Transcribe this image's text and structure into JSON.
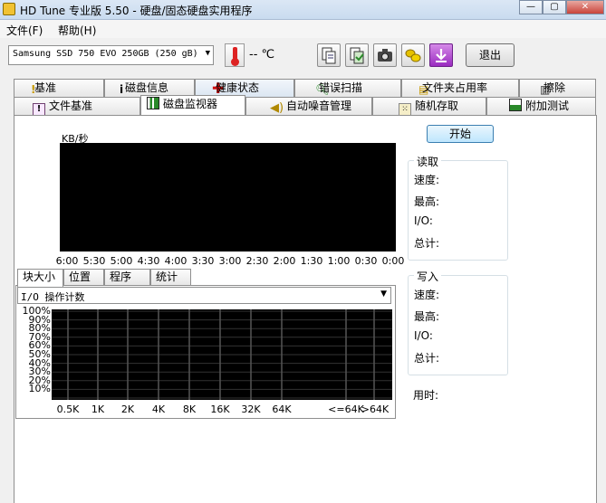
{
  "window": {
    "title": "HD Tune 专业版 5.50 - 硬盘/固态硬盘实用程序",
    "controls": [
      "—",
      "▢",
      "✕"
    ]
  },
  "menu": {
    "file": "文件(F)",
    "help": "帮助(H)"
  },
  "toolbar": {
    "drive": "Samsung SSD 750 EVO 250GB (250 gB)",
    "temperature": "-- ℃",
    "exit_label": "退出",
    "icons": [
      "copy-icon",
      "copy-all-icon",
      "camera-icon",
      "gold-coins-icon",
      "download-icon"
    ]
  },
  "tabs_row1": [
    {
      "label": "基准",
      "icon": "exclamation-icon"
    },
    {
      "label": "磁盘信息",
      "icon": "info-icon"
    },
    {
      "label": "健康状态",
      "icon": "red-cross-icon"
    },
    {
      "label": "错误扫描",
      "icon": "magnifier-icon"
    },
    {
      "label": "文件夹占用率",
      "icon": "folder-icon"
    },
    {
      "label": "擦除",
      "icon": "trash-icon"
    }
  ],
  "tabs_row2": [
    {
      "label": "文件基准",
      "icon": "file-benchmark-icon"
    },
    {
      "label": "磁盘监视器",
      "icon": "monitor-chart-icon",
      "active": true
    },
    {
      "label": "自动噪音管理",
      "icon": "speaker-icon"
    },
    {
      "label": "随机存取",
      "icon": "dice-icon"
    },
    {
      "label": "附加测试",
      "icon": "extra-tests-icon"
    }
  ],
  "monitor": {
    "unit": "KB/秒",
    "start_label": "开始",
    "x_ticks": [
      "6:00",
      "5:30",
      "5:00",
      "4:30",
      "4:00",
      "3:30",
      "3:00",
      "2:30",
      "2:00",
      "1:30",
      "1:00",
      "0:30",
      "0:00"
    ],
    "colors": {
      "graph_bg": "#000000",
      "grid": "#555555"
    }
  },
  "read_group": {
    "title": "读取",
    "speed": "速度:",
    "max": "最高:",
    "io": "I/O:",
    "total": "总计:"
  },
  "write_group": {
    "title": "写入",
    "speed": "速度:",
    "max": "最高:",
    "io": "I/O:",
    "total": "总计:"
  },
  "elapsed_label": "用时:",
  "subtabs": [
    "块大小",
    "位置",
    "程序",
    "统计"
  ],
  "io_select": "I/O 操作计数",
  "histogram": {
    "y_ticks": [
      "100%",
      "90%",
      "80%",
      "70%",
      "60%",
      "50%",
      "40%",
      "30%",
      "20%",
      "10%"
    ],
    "categories": [
      "0.5K",
      "1K",
      "2K",
      "4K",
      "8K",
      "16K",
      "32K",
      "64K",
      "<=64K",
      ">64K"
    ]
  }
}
